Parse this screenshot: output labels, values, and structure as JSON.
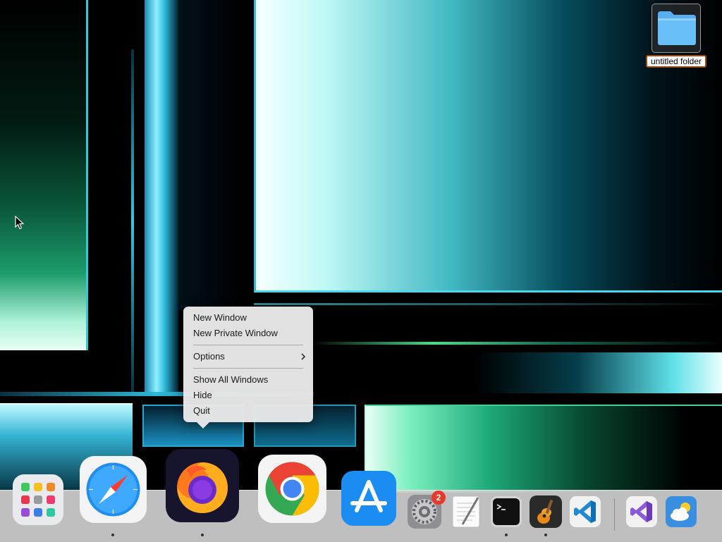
{
  "desktop": {
    "folder_label": "untitled folder"
  },
  "context_menu": {
    "app": "Firefox",
    "items": [
      {
        "label": "New Window"
      },
      {
        "label": "New Private Window"
      },
      {
        "label": "Options",
        "has_submenu": true
      },
      {
        "label": "Show All Windows"
      },
      {
        "label": "Hide"
      },
      {
        "label": "Quit"
      }
    ]
  },
  "dock": {
    "items": [
      {
        "name": "Launchpad",
        "icon": "launchpad-icon",
        "running": false
      },
      {
        "name": "Safari",
        "icon": "safari-icon",
        "running": true
      },
      {
        "name": "Firefox",
        "icon": "firefox-icon",
        "running": true,
        "magnified": true
      },
      {
        "name": "Google Chrome",
        "icon": "chrome-icon",
        "running": false
      },
      {
        "name": "App Store",
        "icon": "app-store-icon",
        "running": false
      },
      {
        "name": "System Preferences",
        "icon": "system-preferences-icon",
        "running": false,
        "badge": "2"
      },
      {
        "name": "TextEdit",
        "icon": "textedit-icon",
        "running": false
      },
      {
        "name": "Terminal",
        "icon": "terminal-icon",
        "running": true
      },
      {
        "name": "GarageBand",
        "icon": "garageband-icon",
        "running": true
      },
      {
        "name": "Visual Studio Code",
        "icon": "vscode-icon",
        "running": false
      },
      {
        "name": "Visual Studio",
        "icon": "visual-studio-icon",
        "running": false
      },
      {
        "name": "Weather",
        "icon": "weather-icon",
        "running": false
      }
    ],
    "badge_color": "#e8392f"
  },
  "colors": {
    "wallpaper_accent": "#8ff5ee",
    "wallpaper_green": "#3ee38c",
    "menu_background": "#e8e8e8"
  }
}
